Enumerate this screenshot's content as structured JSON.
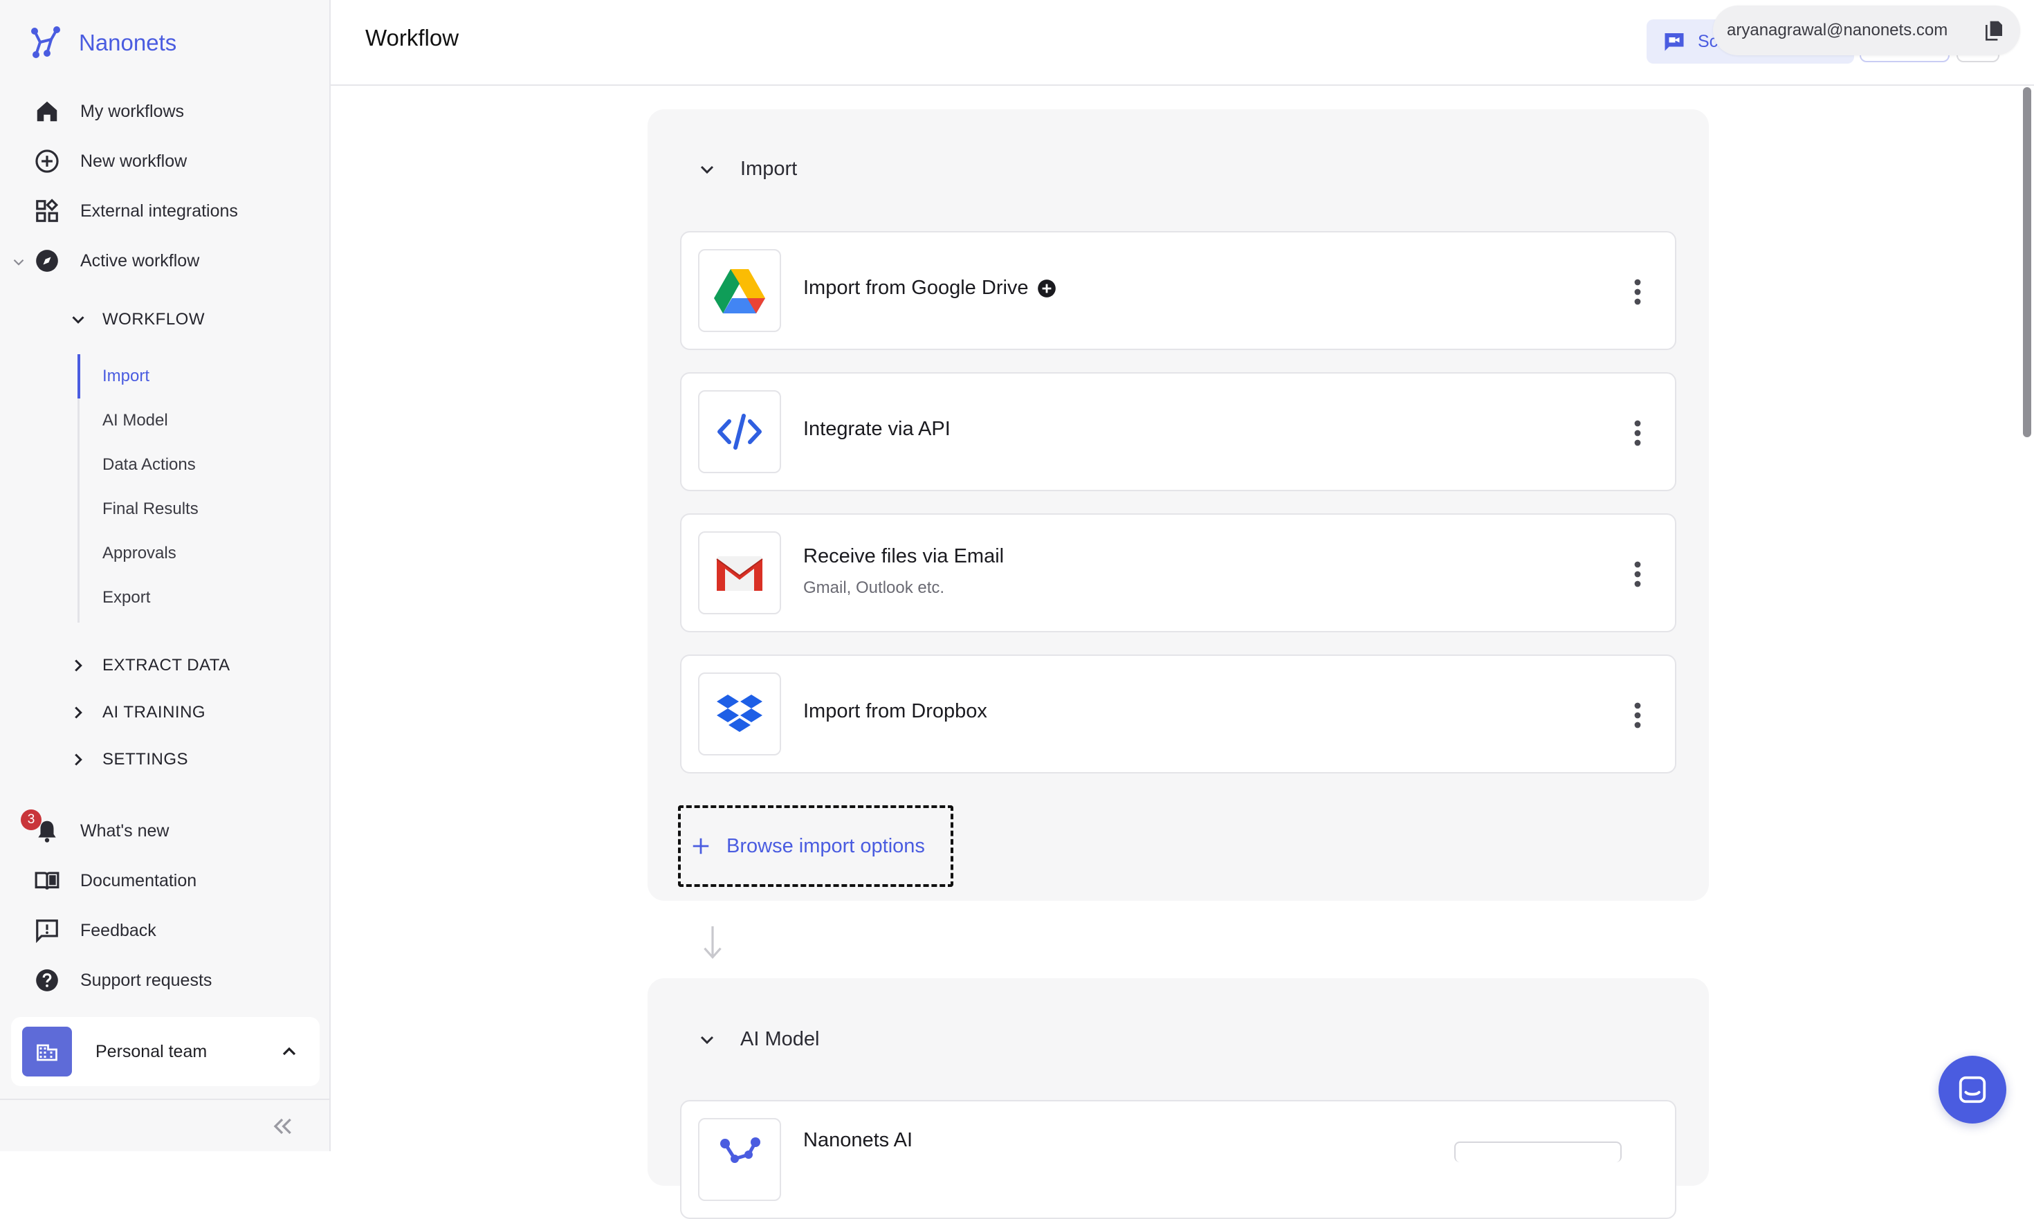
{
  "brand": {
    "name": "Nanonets"
  },
  "sidebar": {
    "nav": [
      {
        "label": "My workflows",
        "icon": "home-icon"
      },
      {
        "label": "New workflow",
        "icon": "plus-circle-icon"
      },
      {
        "label": "External integrations",
        "icon": "integrations-grid-icon"
      },
      {
        "label": "Active workflow",
        "icon": "compass-icon"
      }
    ],
    "workflow_section": "WORKFLOW",
    "workflow_items": [
      "Import",
      "AI Model",
      "Data Actions",
      "Final Results",
      "Approvals",
      "Export"
    ],
    "active_item": "Import",
    "collapsed_sections": [
      "EXTRACT DATA",
      "AI TRAINING",
      "SETTINGS"
    ],
    "bottom_nav": [
      {
        "label": "What's new",
        "icon": "bell-icon"
      },
      {
        "label": "Documentation",
        "icon": "book-icon"
      },
      {
        "label": "Feedback",
        "icon": "feedback-icon"
      },
      {
        "label": "Support requests",
        "icon": "help-icon"
      }
    ],
    "whats_new_badge": "3",
    "team": {
      "name": "Personal team"
    }
  },
  "header": {
    "title": "Workflow",
    "schedule_button": "Sch",
    "user_email": "aryanagrawal@nanonets.com"
  },
  "import_panel": {
    "title": "Import",
    "cards": [
      {
        "title": "Import from Google Drive",
        "subtitle": "",
        "icon": "google-drive-icon"
      },
      {
        "title": "Integrate via API",
        "subtitle": "",
        "icon": "code-icon"
      },
      {
        "title": "Receive files via Email",
        "subtitle": "Gmail, Outlook etc.",
        "icon": "gmail-icon"
      },
      {
        "title": "Import from Dropbox",
        "subtitle": "",
        "icon": "dropbox-icon"
      }
    ],
    "browse_label": "Browse import options"
  },
  "ai_panel": {
    "title": "AI Model",
    "card_title": "Nanonets AI"
  },
  "colors": {
    "accent": "#4a5ce0",
    "badge": "#c9353a",
    "panel_bg": "#f6f6f7"
  }
}
